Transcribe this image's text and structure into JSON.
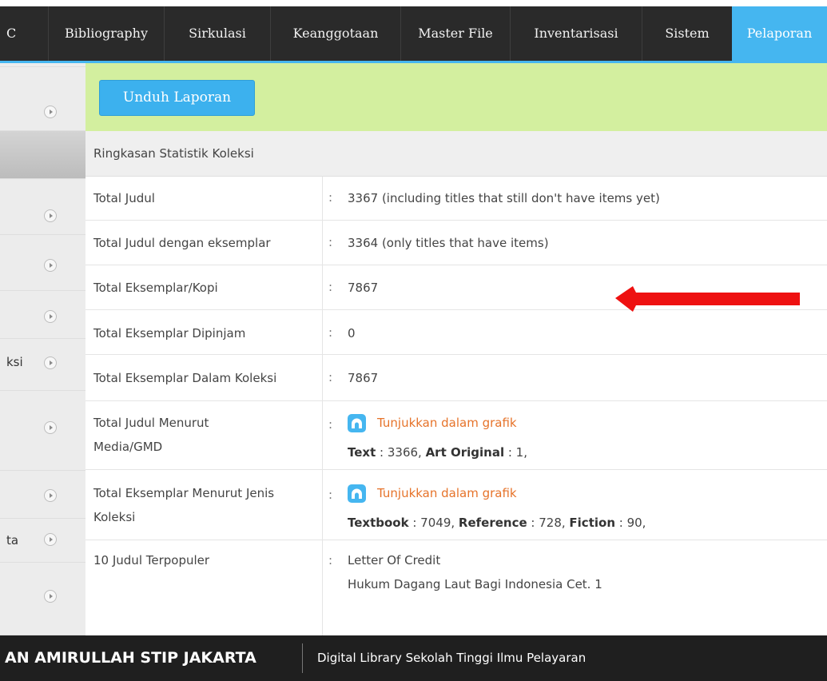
{
  "nav": {
    "items": [
      {
        "label": "C"
      },
      {
        "label": "Bibliography"
      },
      {
        "label": "Sirkulasi"
      },
      {
        "label": "Keanggotaan"
      },
      {
        "label": "Master File"
      },
      {
        "label": "Inventarisasi"
      },
      {
        "label": "Sistem"
      },
      {
        "label": "Pelaporan"
      }
    ],
    "active": "Pelaporan"
  },
  "sidebar": {
    "items": [
      {
        "label": ""
      },
      {
        "label": ""
      },
      {
        "label": ""
      },
      {
        "label": ""
      },
      {
        "label": ""
      },
      {
        "label": ""
      },
      {
        "label": "ksi"
      },
      {
        "label": ""
      },
      {
        "label": ""
      },
      {
        "label": "ta"
      },
      {
        "label": ""
      }
    ]
  },
  "actions": {
    "download_label": "Unduh Laporan"
  },
  "stats": {
    "title": "Ringkasan Statistik Koleksi",
    "separator": ":",
    "rows": {
      "total_judul": {
        "label": "Total Judul",
        "value": "3367 (including titles that still don't have items yet)"
      },
      "total_judul_eksemplar": {
        "label": "Total Judul dengan eksemplar",
        "value": "3364 (only titles that have items)"
      },
      "total_eksemplar": {
        "label": "Total Eksemplar/Kopi",
        "value": "7867"
      },
      "total_dipinjam": {
        "label": "Total Eksemplar Dipinjam",
        "value": "0"
      },
      "total_dalam_koleksi": {
        "label": "Total Eksemplar Dalam Koleksi",
        "value": "7867"
      },
      "judul_media": {
        "label_line1": "Total Judul Menurut",
        "label_line2": "Media/GMD",
        "link": "Tunjukkan dalam grafik",
        "b1": "Text",
        "v1": " : 3366, ",
        "b2": "Art Original",
        "v2": " : 1,"
      },
      "eksemplar_jenis": {
        "label_line1": "Total Eksemplar Menurut Jenis",
        "label_line2": "Koleksi",
        "link": "Tunjukkan dalam grafik",
        "b1": "Textbook",
        "v1": " : 7049, ",
        "b2": "Reference",
        "v2": " : 728, ",
        "b3": "Fiction",
        "v3": " : 90,"
      },
      "populer": {
        "label": "10 Judul Terpopuler",
        "titles": [
          "Letter Of Credit",
          "Hukum Dagang Laut Bagi Indonesia Cet. 1"
        ]
      }
    }
  },
  "footer": {
    "left": "AN AMIRULLAH STIP JAKARTA",
    "right": "Digital Library Sekolah Tinggi Ilmu Pelayaran"
  },
  "colors": {
    "accent": "#45b6f0",
    "action_bar": "#d3ef9f",
    "link": "#e6732a",
    "annotation_arrow": "#ee1111"
  }
}
